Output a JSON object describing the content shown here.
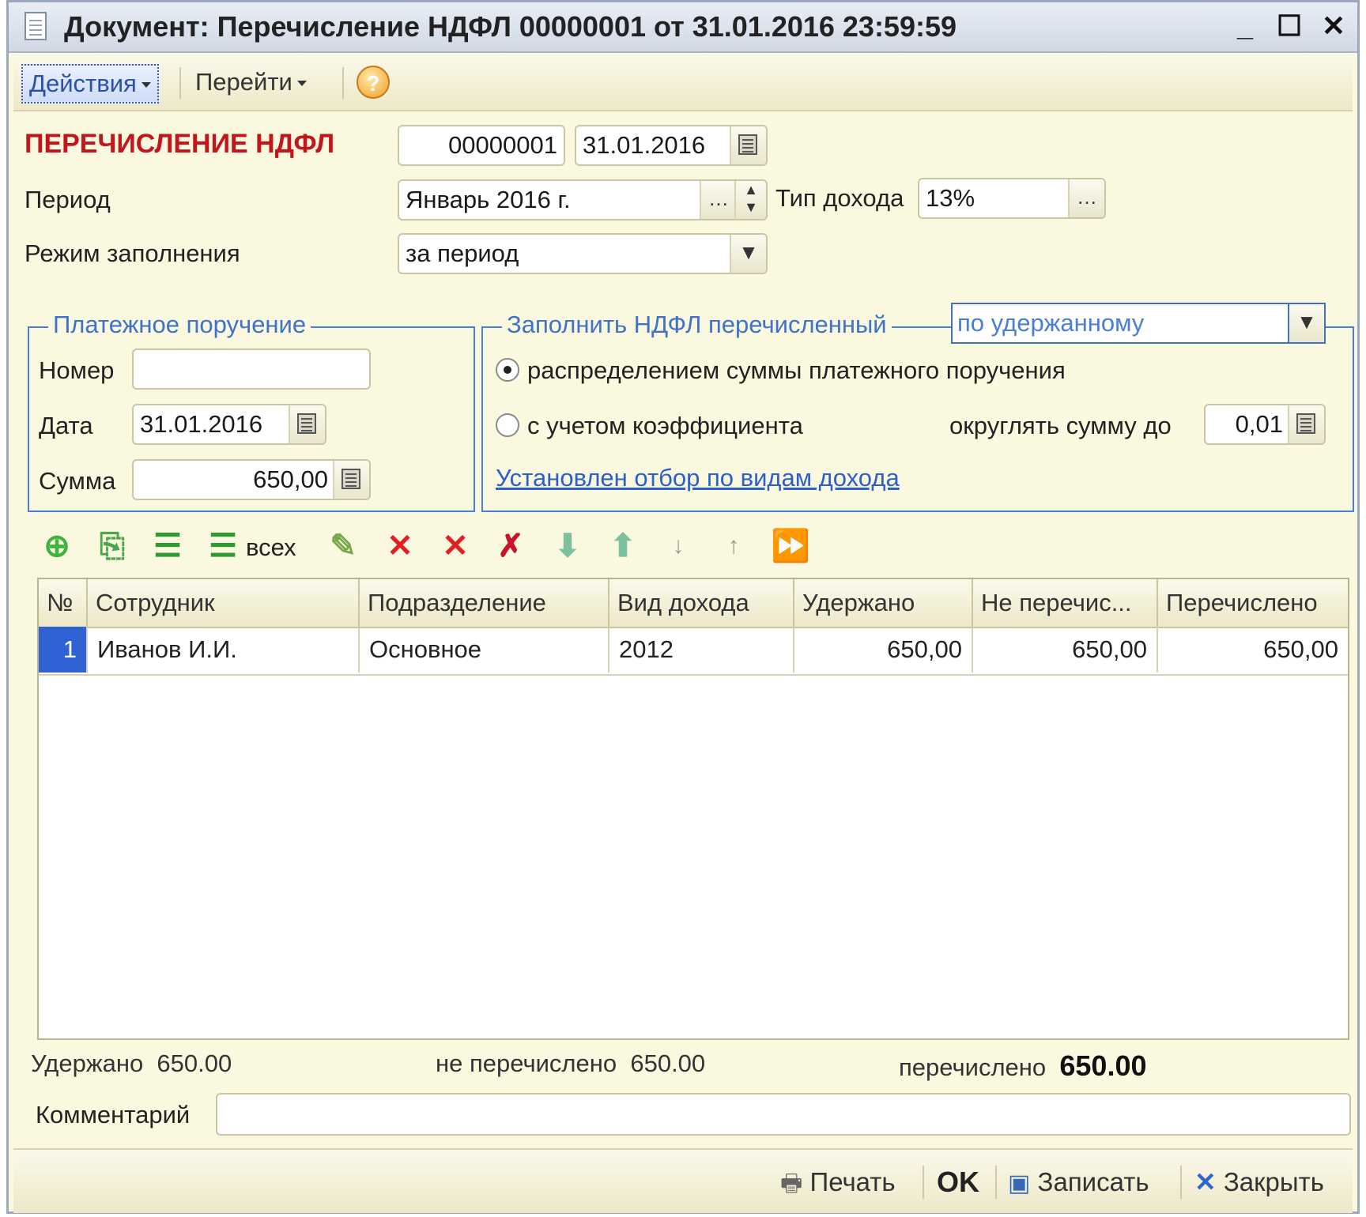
{
  "window": {
    "title": "Документ: Перечисление НДФЛ 00000001 от 31.01.2016 23:59:59",
    "controls": {
      "minimize": "_",
      "maximize": "☐",
      "close": "✕"
    }
  },
  "toolbar": {
    "actions_label": "Действия",
    "goto_label": "Перейти",
    "help_label": "?"
  },
  "header": {
    "doc_type": "ПЕРЕЧИСЛЕНИЕ НДФЛ",
    "number": "00000001",
    "date": "31.01.2016",
    "period_label": "Период",
    "period_value": "Январь 2016 г.",
    "income_type_label": "Тип дохода",
    "income_type_value": "13%",
    "fill_mode_label": "Режим заполнения",
    "fill_mode_value": "за период"
  },
  "payment_order": {
    "title": "Платежное поручение",
    "number_label": "Номер",
    "number_value": "",
    "date_label": "Дата",
    "date_value": "31.01.2016",
    "sum_label": "Сумма",
    "sum_value": "650,00"
  },
  "fill_transferred": {
    "title": "Заполнить НДФЛ перечисленный",
    "mode_value": "по удержанному",
    "option1": "распределением суммы платежного поручения",
    "option2": "с учетом коэффициента",
    "selected_option": "option1",
    "round_label": "округлять сумму до",
    "round_value": "0,01",
    "filter_link": "Установлен отбор по видам дохода"
  },
  "table_toolbar": {
    "all_label": "всех",
    "icons": [
      "add-icon",
      "copy-icon",
      "fill-icon",
      "fill-all-icon",
      "edit-icon",
      "delete-icon",
      "clear-icon",
      "delete-marked-icon",
      "move-down-icon",
      "move-up-icon",
      "sort-asc-icon",
      "sort-desc-icon",
      "fast-forward-icon"
    ]
  },
  "table": {
    "columns": [
      "№",
      "Сотрудник",
      "Подразделение",
      "Вид дохода",
      "Удержано",
      "Не перечис...",
      "Перечислено"
    ],
    "rows": [
      {
        "num": "1",
        "employee": "Иванов И.И.",
        "department": "Основное",
        "income_type": "2012",
        "withheld": "650,00",
        "not_transferred": "650,00",
        "transferred": "650,00"
      }
    ]
  },
  "totals": {
    "withheld_label": "Удержано",
    "withheld_value": "650.00",
    "not_transferred_label": "не перечислено",
    "not_transferred_value": "650.00",
    "transferred_label": "перечислено",
    "transferred_value": "650.00"
  },
  "comment": {
    "label": "Комментарий",
    "value": ""
  },
  "footer": {
    "print_label": "Печать",
    "ok_label": "OK",
    "save_label": "Записать",
    "close_label": "Закрыть"
  },
  "colors": {
    "accent": "#2f63d3",
    "heading": "#c3161c",
    "group_border": "#4a7ed8",
    "background": "#fbf8e0"
  }
}
